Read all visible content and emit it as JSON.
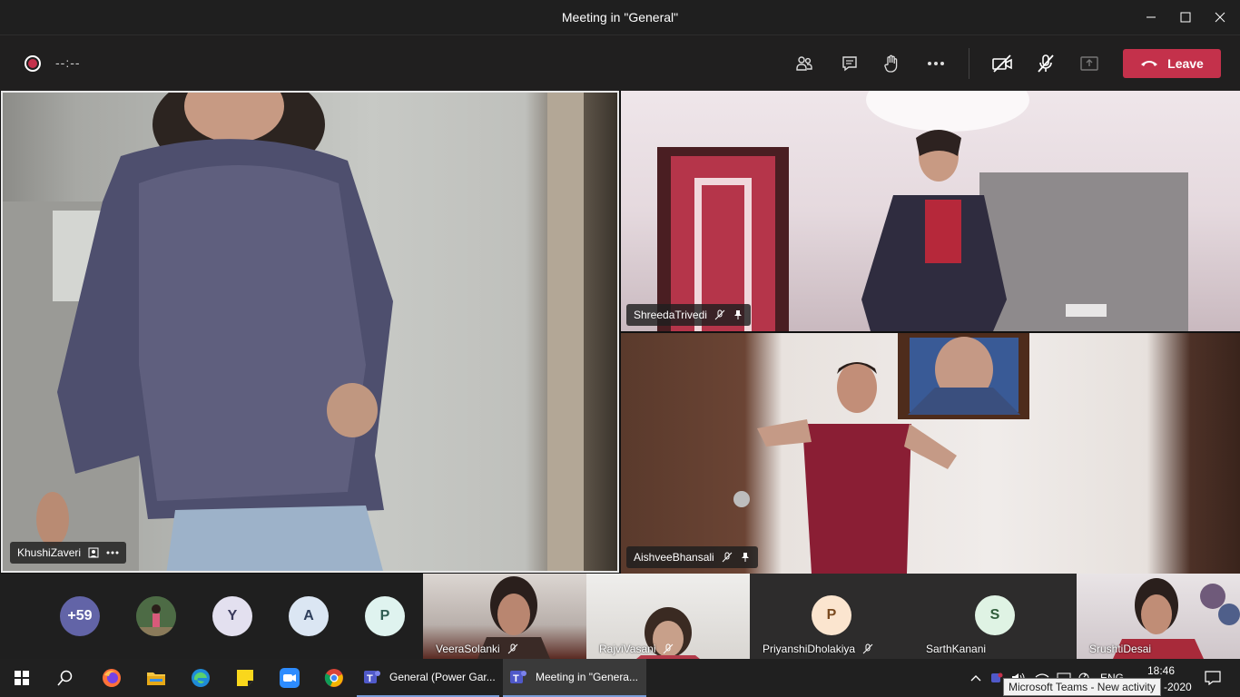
{
  "window": {
    "title": "Meeting in \"General\""
  },
  "toolbar": {
    "timer": "--:--",
    "leave_label": "Leave",
    "icons": [
      "people-icon",
      "chat-icon",
      "raise-hand-icon",
      "more-icon",
      "camera-off-icon",
      "mic-off-icon",
      "share-tray-icon"
    ]
  },
  "tiles": {
    "main": {
      "name": "KhushiZaveri"
    },
    "top_right": {
      "name": "ShreedaTrivedi"
    },
    "bottom_right": {
      "name": "AishveeBhansali"
    }
  },
  "strip": {
    "overflow_count": "+59",
    "avatars": [
      {
        "initial": "Y",
        "color": "#e3e0ef",
        "fg": "#3a3a5c"
      },
      {
        "initial": "A",
        "color": "#dbe6f3",
        "fg": "#2f3f5c"
      },
      {
        "initial": "P",
        "color": "#dff3ef",
        "fg": "#2f5c52"
      }
    ],
    "videos": [
      {
        "name": "VeeraSolanki"
      },
      {
        "name": "RajviVasani"
      }
    ],
    "audio_tiles": [
      {
        "name": "PriyanshiDholakiya",
        "initial": "P",
        "color": "#fbe5cf",
        "fg": "#7a4a1f"
      },
      {
        "name": "SarthKanani",
        "initial": "S",
        "color": "#dff3e4",
        "fg": "#2f5c3a"
      }
    ],
    "last_video": {
      "name": "SrushtiDesai"
    }
  },
  "taskbar": {
    "apps": [
      {
        "label": "General (Power Gar..."
      },
      {
        "label": "Meeting in \"Genera..."
      }
    ],
    "clock_time": "18:46",
    "clock_date": "-2020",
    "lang": "ENG",
    "tooltip": "Microsoft Teams - New activity"
  }
}
